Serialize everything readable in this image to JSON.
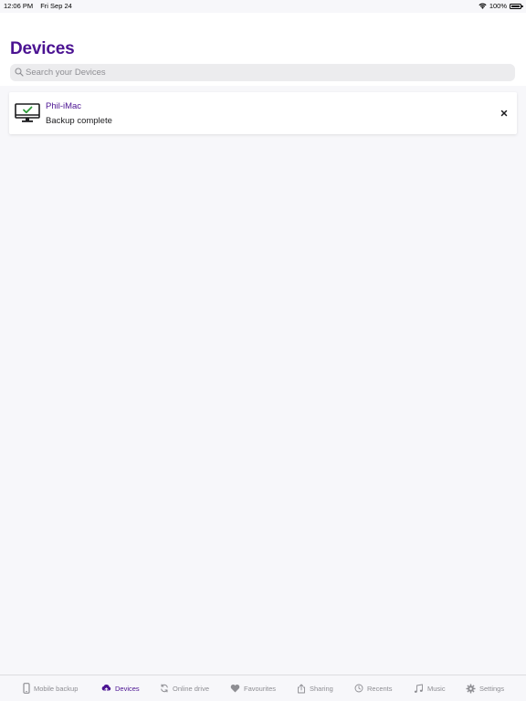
{
  "status_bar": {
    "time": "12:06 PM",
    "date": "Fri Sep 24",
    "battery": "100%"
  },
  "page": {
    "title": "Devices"
  },
  "search": {
    "placeholder": "Search your Devices"
  },
  "devices": [
    {
      "name": "Phil-iMac",
      "status": "Backup complete",
      "icon": "monitor-check-icon"
    }
  ],
  "tabs": [
    {
      "label": "Mobile backup",
      "icon": "phone-icon",
      "active": false
    },
    {
      "label": "Devices",
      "icon": "cloud-upload-icon",
      "active": true
    },
    {
      "label": "Online drive",
      "icon": "sync-icon",
      "active": false
    },
    {
      "label": "Favourites",
      "icon": "heart-icon",
      "active": false
    },
    {
      "label": "Sharing",
      "icon": "share-icon",
      "active": false
    },
    {
      "label": "Recents",
      "icon": "clock-icon",
      "active": false
    },
    {
      "label": "Music",
      "icon": "music-note-icon",
      "active": false
    },
    {
      "label": "Settings",
      "icon": "gear-icon",
      "active": false
    }
  ],
  "colors": {
    "accent": "#4b1392",
    "inactive": "#8e8e93",
    "background": "#f7f7fa"
  }
}
